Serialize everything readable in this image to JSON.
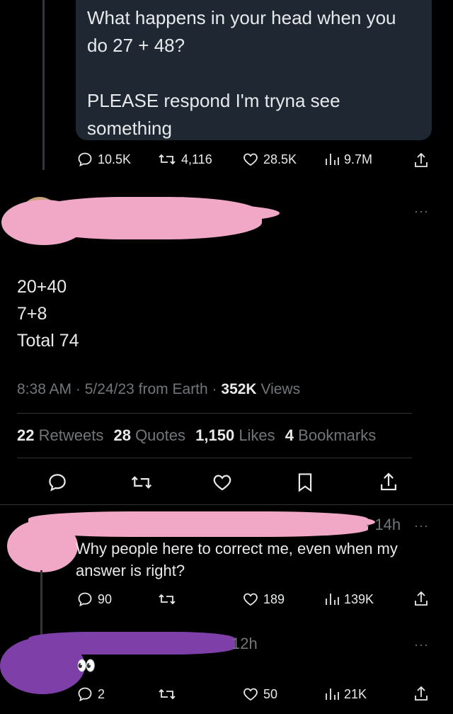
{
  "quoted_tweet": {
    "line1": "What happens in your head when you",
    "line2": "do 27 + 48?",
    "line3": "PLEASE respond I'm tryna see",
    "line4": "something"
  },
  "quoted_actions": {
    "replies": "10.5K",
    "retweets": "4,116",
    "likes": "28.5K",
    "views": "9.7M"
  },
  "main_tweet": {
    "lines": [
      "20+40",
      "7+8",
      "Total 74"
    ],
    "time": "8:38 AM",
    "date": "5/24/23",
    "source": "from Earth",
    "views_count": "352K",
    "views_label": "Views",
    "sep": "·",
    "retweets_count": "22",
    "retweets_label": "Retweets",
    "quotes_count": "28",
    "quotes_label": "Quotes",
    "likes_count": "1,150",
    "likes_label": "Likes",
    "bookmarks_count": "4",
    "bookmarks_label": "Bookmarks"
  },
  "reply1": {
    "time": "· 14h",
    "text_line1": "Why people here to correct me, even when my",
    "text_line2": "answer is right?",
    "replies": "90",
    "likes": "189",
    "views": "139K"
  },
  "reply2": {
    "time": "12h",
    "text": "👀",
    "replies": "2",
    "likes": "50",
    "views": "21K"
  },
  "more_label": "···"
}
